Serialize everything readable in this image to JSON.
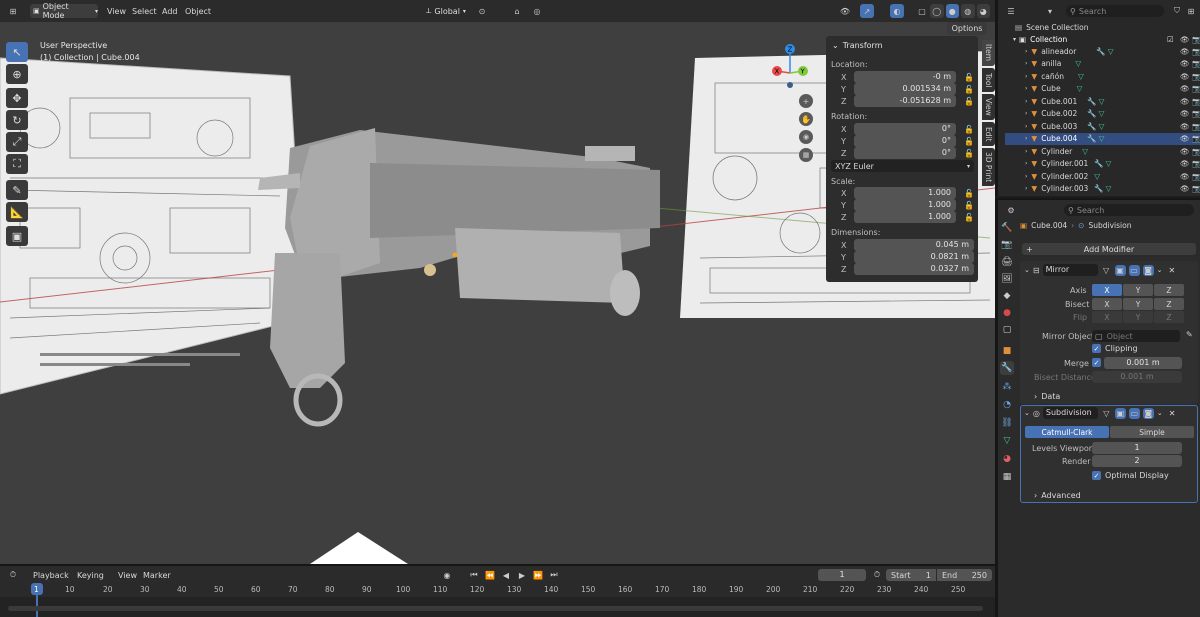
{
  "header": {
    "editor_icon": "3d-viewport-icon",
    "mode": "Object Mode",
    "menus": [
      "View",
      "Select",
      "Add",
      "Object"
    ],
    "orientation": "Global",
    "options": "Options"
  },
  "viewport": {
    "perspective": "User Perspective",
    "collection": "(1) Collection | Cube.004"
  },
  "tabs": [
    "Item",
    "Tool",
    "View",
    "Edit",
    "3D Print"
  ],
  "transform": {
    "title": "Transform",
    "location_label": "Location:",
    "location": [
      {
        "axis": "X",
        "value": "-0 m"
      },
      {
        "axis": "Y",
        "value": "0.001534 m"
      },
      {
        "axis": "Z",
        "value": "-0.051628 m"
      }
    ],
    "rotation_label": "Rotation:",
    "rotation": [
      {
        "axis": "X",
        "value": "0°"
      },
      {
        "axis": "Y",
        "value": "0°"
      },
      {
        "axis": "Z",
        "value": "0°"
      }
    ],
    "rotation_mode": "XYZ Euler",
    "scale_label": "Scale:",
    "scale": [
      {
        "axis": "X",
        "value": "1.000"
      },
      {
        "axis": "Y",
        "value": "1.000"
      },
      {
        "axis": "Z",
        "value": "1.000"
      }
    ],
    "dimensions_label": "Dimensions:",
    "dimensions": [
      {
        "axis": "X",
        "value": "0.045 m"
      },
      {
        "axis": "Y",
        "value": "0.0821 m"
      },
      {
        "axis": "Z",
        "value": "0.0327 m"
      }
    ]
  },
  "outliner": {
    "search_placeholder": "Search",
    "root": "Scene Collection",
    "collection": "Collection",
    "items": [
      "alineador",
      "anilla",
      "cañón",
      "Cube",
      "Cube.001",
      "Cube.002",
      "Cube.003",
      "Cube.004",
      "Cylinder",
      "Cylinder.001",
      "Cylinder.002",
      "Cylinder.003"
    ]
  },
  "properties": {
    "search_placeholder": "Search",
    "object": "Cube.004",
    "modifier_crumb": "Subdivision",
    "add_modifier": "Add Modifier",
    "mirror": {
      "name": "Mirror",
      "axis_label": "Axis",
      "bisect_label": "Bisect",
      "flip_label": "Flip",
      "x": "X",
      "y": "Y",
      "z": "Z",
      "mirror_object_label": "Mirror Object",
      "mirror_object_placeholder": "Object",
      "clipping": "Clipping",
      "merge_label": "Merge",
      "merge_value": "0.001 m",
      "bisect_distance_label": "Bisect Distance",
      "bisect_distance_value": "0.001 m",
      "data": "Data"
    },
    "subdivision": {
      "name": "Subdivision",
      "catmull": "Catmull-Clark",
      "simple": "Simple",
      "levels_label": "Levels Viewport",
      "levels_value": "1",
      "render_label": "Render",
      "render_value": "2",
      "optimal": "Optimal Display",
      "advanced": "Advanced"
    }
  },
  "timeline": {
    "menus": [
      "Playback",
      "Keying",
      "View",
      "Marker"
    ],
    "current_frame": "1",
    "start_label": "Start",
    "start": "1",
    "end_label": "End",
    "end": "250",
    "ticks": [
      "1",
      "10",
      "20",
      "30",
      "40",
      "50",
      "60",
      "70",
      "80",
      "90",
      "100",
      "110",
      "120",
      "130",
      "140",
      "150",
      "160",
      "170",
      "180",
      "190",
      "200",
      "210",
      "220",
      "230",
      "240",
      "250"
    ]
  },
  "colors": {
    "accent": "#4772b3",
    "x_axis": "#e74a4a",
    "y_axis": "#7fc93a",
    "z_axis": "#2e8de8",
    "object_orange": "#e0903c",
    "modifier_blue": "#6aa7e5",
    "mesh_green": "#3ec9a0"
  }
}
